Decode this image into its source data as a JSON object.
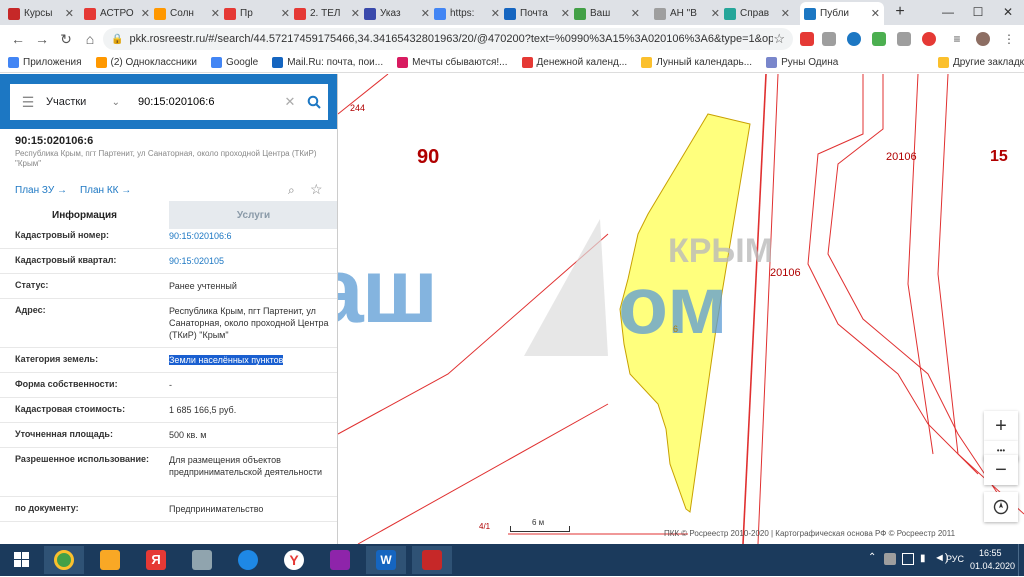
{
  "browser": {
    "tabs": [
      {
        "label": "Курсы",
        "fav": "#c62828",
        "active": false
      },
      {
        "label": "АСТРО",
        "fav": "#e53935",
        "active": false
      },
      {
        "label": "Солн",
        "fav": "#ff9800",
        "active": false
      },
      {
        "label": "Пр",
        "fav": "#e53935",
        "active": false
      },
      {
        "label": "2. ТЕЛ",
        "fav": "#e53935",
        "active": false
      },
      {
        "label": "Указ",
        "fav": "#3949ab",
        "active": false
      },
      {
        "label": "https:",
        "fav": "#4285f4",
        "active": false
      },
      {
        "label": "Почта",
        "fav": "#1565c0",
        "active": false
      },
      {
        "label": "Ваш",
        "fav": "#43a047",
        "active": false
      },
      {
        "label": "АН \"В",
        "fav": "#9e9e9e",
        "active": false
      },
      {
        "label": "Справ",
        "fav": "#26a69a",
        "active": false
      },
      {
        "label": "Публи",
        "fav": "#1c77c3",
        "active": true
      }
    ],
    "url": "pkk.rosreestr.ru/#/search/44.57217459175466,34.34165432801963/20/@470200?text=%0990%3A15%3A020106%3A6&type=1&open...",
    "bookmarks": [
      {
        "label": "Приложения",
        "fav": "#4285f4"
      },
      {
        "label": "(2) Одноклассники",
        "fav": "#ff9800"
      },
      {
        "label": "Google",
        "fav": "#4285f4"
      },
      {
        "label": "Mail.Ru: почта, пои...",
        "fav": "#1565c0"
      },
      {
        "label": "Мечты сбываются!...",
        "fav": "#d81b60"
      },
      {
        "label": "Денежной календ...",
        "fav": "#e53935"
      },
      {
        "label": "Лунный календарь...",
        "fav": "#fbc02d"
      },
      {
        "label": "Руны Одина",
        "fav": "#7986cb"
      }
    ],
    "other_bookmarks": "Другие закладки"
  },
  "search": {
    "category": "Участки",
    "query": "90:15:020106:6"
  },
  "object": {
    "number": "90:15:020106:6",
    "address": "Республика Крым, пгт Партенит, ул Санаторная, около проходной Центра (ТКиР) \"Крым\"",
    "link_zu": "План ЗУ →",
    "link_kk": "План КК →",
    "tab_info": "Информация",
    "tab_services": "Услуги"
  },
  "attributes": [
    {
      "key": "Кадастровый номер:",
      "value": "90:15:020106:6",
      "link": true
    },
    {
      "key": "Кадастровый квартал:",
      "value": "90:15:020105",
      "link": true
    },
    {
      "key": "Статус:",
      "value": "Ранее учтенный",
      "link": false
    },
    {
      "key": "Адрес:",
      "value": "Республика Крым, пгт Партенит, ул Санаторная, около проходной Центра (ТКиР) \"Крым\"",
      "link": false
    },
    {
      "key": "Категория земель:",
      "value": "Земли населённых пунктов",
      "link": false,
      "selected": true
    },
    {
      "key": "Форма собственности:",
      "value": "-",
      "link": false
    },
    {
      "key": "Кадастровая стоимость:",
      "value": "1 685 166,5 руб.",
      "link": false
    },
    {
      "key": "Уточненная площадь:",
      "value": "500 кв. м",
      "link": false
    },
    {
      "key": "Разрешенное использование:",
      "value": "Для размещения объектов предпринимательской деятельности",
      "link": false
    },
    {
      "key": "по документу:",
      "value": "Предпринимательство",
      "link": false
    }
  ],
  "map": {
    "labels": {
      "l90": "90",
      "l20106a": "20106",
      "l15": "15",
      "l20106b": "20106",
      "l244": "244",
      "parcel": "6",
      "l41": "4/1"
    },
    "scale": "6 м",
    "attribution": "ПКК © Росреестр 2010-2020 | Картографическая основа РФ © Росреестр 2011",
    "watermark_text": "Ваш",
    "watermark_text2": "ом",
    "watermark_sub": "КРЫМ",
    "zoom_in": "+",
    "zoom_out": "−",
    "more": "•••"
  },
  "taskbar": {
    "lang": "РУС",
    "time": "16:55",
    "date": "01.04.2020"
  },
  "colors": {
    "accent": "#1c77c3",
    "parcel_fill": "#ffff66",
    "parcel_border": "#c8a000",
    "boundary": "#e03030",
    "label_red": "#b00000"
  }
}
